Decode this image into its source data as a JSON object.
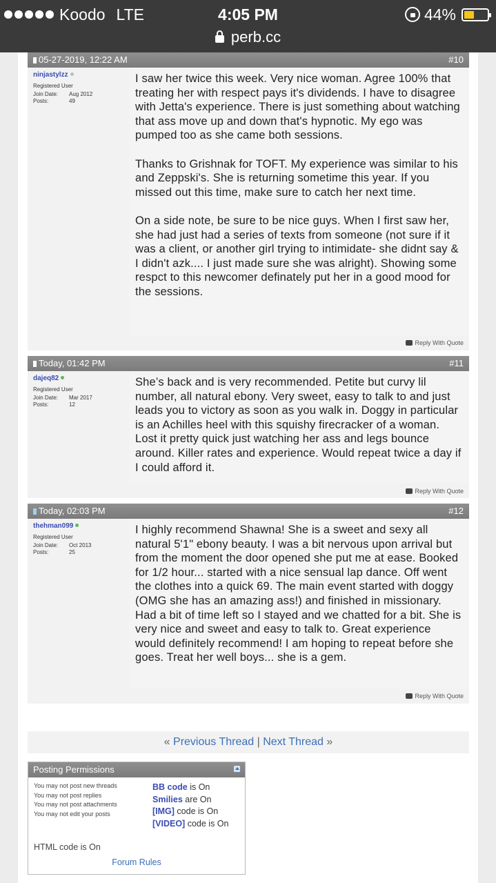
{
  "status": {
    "carrier": "Koodo",
    "network": "LTE",
    "time": "4:05 PM",
    "battery": "44%",
    "battery_level": 0.44,
    "url": "perb.cc"
  },
  "posts": [
    {
      "date": "05-27-2019, 12:22 AM",
      "number": "#10",
      "username": "ninjastylzz",
      "online": false,
      "role": "Registered User",
      "join_label": "Join Date:",
      "join_date": "Aug 2012",
      "posts_label": "Posts:",
      "posts": "49",
      "body": "I saw her twice this week. Very nice woman. Agree 100% that treating her with respect pays it's dividends. I have to disagree with Jetta's experience. There is just something about watching that ass move up and down that's hypnotic. My ego was pumped too as she came both sessions.\n\nThanks to Grishnak for TOFT. My experience was similar to his and Zeppski's. She is returning sometime this year. If you missed out this time, make sure to catch her next time.\n\nOn a side note, be sure to be nice guys. When I first saw her, she had just had a series of texts from someone (not sure if it was a client, or another girl trying to intimidate- she didnt say & I didn't azk.... I just made sure she was alright). Showing some respct to this newcomer definately put her in a good mood for the sessions.",
      "reply": "Reply With Quote"
    },
    {
      "date": "Today, 01:42 PM",
      "number": "#11",
      "username": "dajeq82",
      "online": true,
      "role": "Registered User",
      "join_label": "Join Date:",
      "join_date": "Mar 2017",
      "posts_label": "Posts:",
      "posts": "12",
      "body": "She’s back and is very recommended. Petite but curvy lil number, all natural ebony. Very sweet, easy to talk to and just leads you to victory as soon as you walk in. Doggy in particular is an Achilles heel with this squishy firecracker of a woman. Lost it pretty quick just watching her ass and legs bounce around. Killer rates and experience. Would repeat twice a day if I could afford it.",
      "reply": "Reply With Quote"
    },
    {
      "date": "Today, 02:03 PM",
      "number": "#12",
      "username": "thehman099",
      "online": true,
      "role": "Registered User",
      "join_label": "Join Date:",
      "join_date": "Oct 2013",
      "posts_label": "Posts:",
      "posts": "25",
      "body": "I highly recommend Shawna! She is a sweet and sexy all natural 5'1\" ebony beauty. I was a bit nervous upon arrival but from the moment the door opened she put me at ease. Booked for 1/2 hour... started with a nice sensual lap dance. Off went the clothes into a quick 69. The main event started with doggy (OMG she has an amazing ass!) and finished in missionary. Had a bit of time left so I stayed and we chatted for a bit. She is very nice and sweet and easy to talk to. Great experience would definitely recommend! I am hoping to repeat before she goes. Treat her well boys... she is a gem.",
      "reply": "Reply With Quote"
    }
  ],
  "nav": {
    "prev_arrow": "«",
    "prev": "Previous Thread",
    "sep": "|",
    "next": "Next Thread",
    "next_arrow": "»"
  },
  "permissions": {
    "title": "Posting Permissions",
    "rules": [
      "You may not post new threads",
      "You may not post replies",
      "You may not post attachments",
      "You may not edit your posts"
    ],
    "bbcode_label": "BB code",
    "bbcode_state": "is On",
    "smilies_label": "Smilies",
    "smilies_state": "are On",
    "img_label": "[IMG]",
    "img_state": "code is On",
    "video_label": "[VIDEO]",
    "video_state": "code is On",
    "html": "HTML code is On",
    "forum_rules": "Forum Rules"
  }
}
